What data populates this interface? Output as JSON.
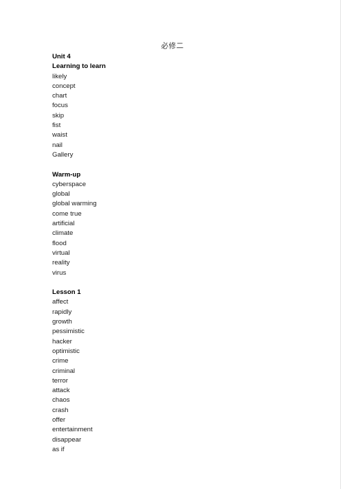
{
  "document": {
    "title": "必修二",
    "right_rule_color": "#e3e3e3",
    "background_color": "#ffffff",
    "text_color": "#1a1a1a"
  },
  "sections": [
    {
      "headings": [
        "Unit 4",
        "Learning to learn"
      ],
      "words": [
        "likely",
        "concept",
        "chart",
        "focus",
        "skip",
        "fist",
        "waist",
        "nail",
        "Gallery"
      ]
    },
    {
      "headings": [
        "Warm-up"
      ],
      "words": [
        "cyberspace",
        "global",
        "global warming",
        "come true",
        "artificial",
        "climate",
        "flood",
        "virtual",
        "reality",
        "virus"
      ]
    },
    {
      "headings": [
        "Lesson 1"
      ],
      "words": [
        "affect",
        "rapidly",
        "growth",
        "pessimistic",
        "hacker",
        "optimistic",
        "crime",
        "criminal",
        "terror",
        "attack",
        "chaos",
        "crash",
        "offer",
        "entertainment",
        "disappear",
        "as if"
      ]
    }
  ]
}
